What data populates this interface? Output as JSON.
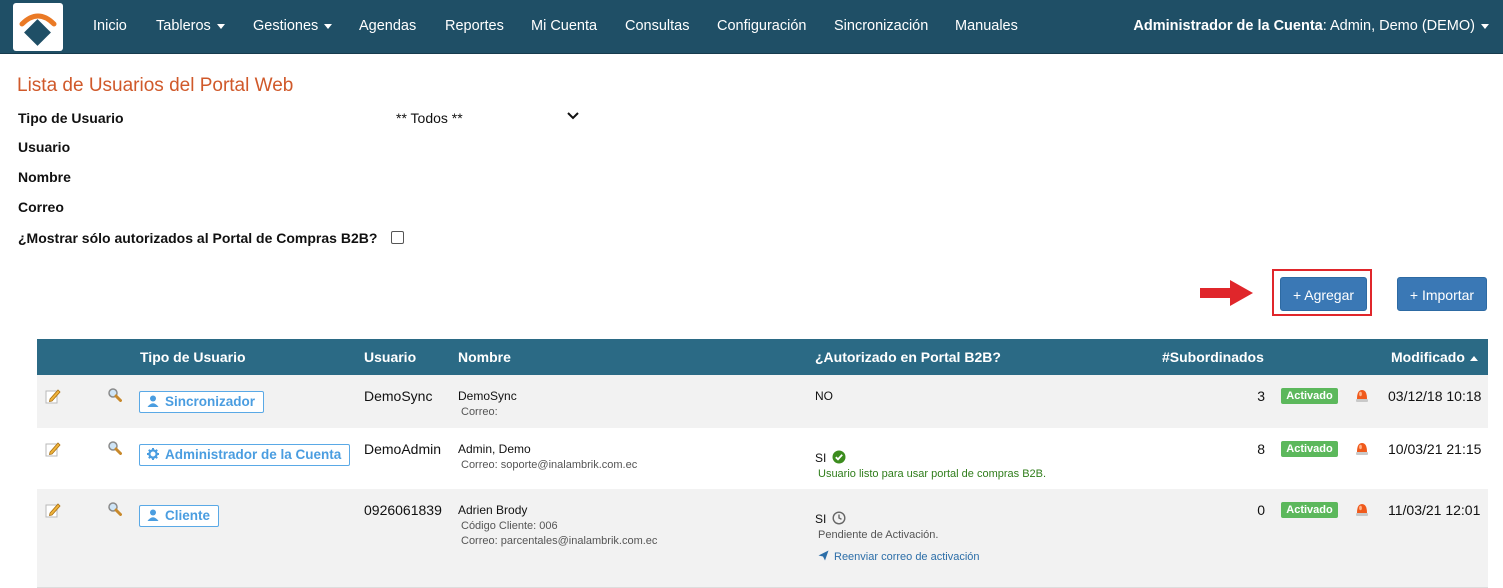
{
  "nav": {
    "items": [
      {
        "label": "Inicio",
        "dropdown": false
      },
      {
        "label": "Tableros",
        "dropdown": true
      },
      {
        "label": "Gestiones",
        "dropdown": true
      },
      {
        "label": "Agendas",
        "dropdown": false
      },
      {
        "label": "Reportes",
        "dropdown": false
      },
      {
        "label": "Mi Cuenta",
        "dropdown": false
      },
      {
        "label": "Consultas",
        "dropdown": false
      },
      {
        "label": "Configuración",
        "dropdown": false
      },
      {
        "label": "Sincronización",
        "dropdown": false
      },
      {
        "label": "Manuales",
        "dropdown": false
      }
    ],
    "user_role": "Administrador de la Cuenta",
    "user_name": ": Admin, Demo (DEMO)",
    "bar_color": "#1f4f66"
  },
  "page": {
    "title": "Lista de Usuarios del Portal Web",
    "filters": {
      "tipo_label": "Tipo de Usuario",
      "tipo_value": "** Todos **",
      "usuario_label": "Usuario",
      "nombre_label": "Nombre",
      "correo_label": "Correo",
      "b2b_label": "¿Mostrar sólo autorizados al Portal de Compras B2B?",
      "b2b_checked": false
    },
    "buttons": {
      "agregar": "+ Agregar",
      "importar": "+ Importar"
    }
  },
  "table": {
    "headers": {
      "tipo": "Tipo de Usuario",
      "usuario": "Usuario",
      "nombre": "Nombre",
      "autorizado": "¿Autorizado en Portal B2B?",
      "subordinados": "#Subordinados",
      "modificado": "Modificado"
    },
    "rows": [
      {
        "tipo": "Sincronizador",
        "tipo_icon": "user-icon",
        "usuario": "DemoSync",
        "nombre": "DemoSync",
        "detalle1": "Correo:",
        "detalle2": "",
        "autorizado": "NO",
        "auth_icon": "",
        "auth_note": "",
        "auth_link": "",
        "subordinados": "3",
        "estado": "Activado",
        "modificado": "03/12/18 10:18"
      },
      {
        "tipo": "Administrador de la Cuenta",
        "tipo_icon": "gear-icon",
        "usuario": "DemoAdmin",
        "nombre": "Admin, Demo",
        "detalle1": "Correo: soporte@inalambrik.com.ec",
        "detalle2": "",
        "autorizado": "SI",
        "auth_icon": "check-circle-icon",
        "auth_note": "Usuario listo para usar portal de compras B2B.",
        "auth_link": "",
        "subordinados": "8",
        "estado": "Activado",
        "modificado": "10/03/21 21:15"
      },
      {
        "tipo": "Cliente",
        "tipo_icon": "user-icon",
        "usuario": "0926061839",
        "nombre": "Adrien Brody",
        "detalle1": "Código Cliente: 006",
        "detalle2": "Correo: parcentales@inalambrik.com.ec",
        "autorizado": "SI",
        "auth_icon": "clock-icon",
        "auth_note": "Pendiente de Activación.",
        "auth_link": "Reenviar correo de activación",
        "subordinados": "0",
        "estado": "Activado",
        "modificado": "11/03/21 12:01"
      }
    ]
  }
}
